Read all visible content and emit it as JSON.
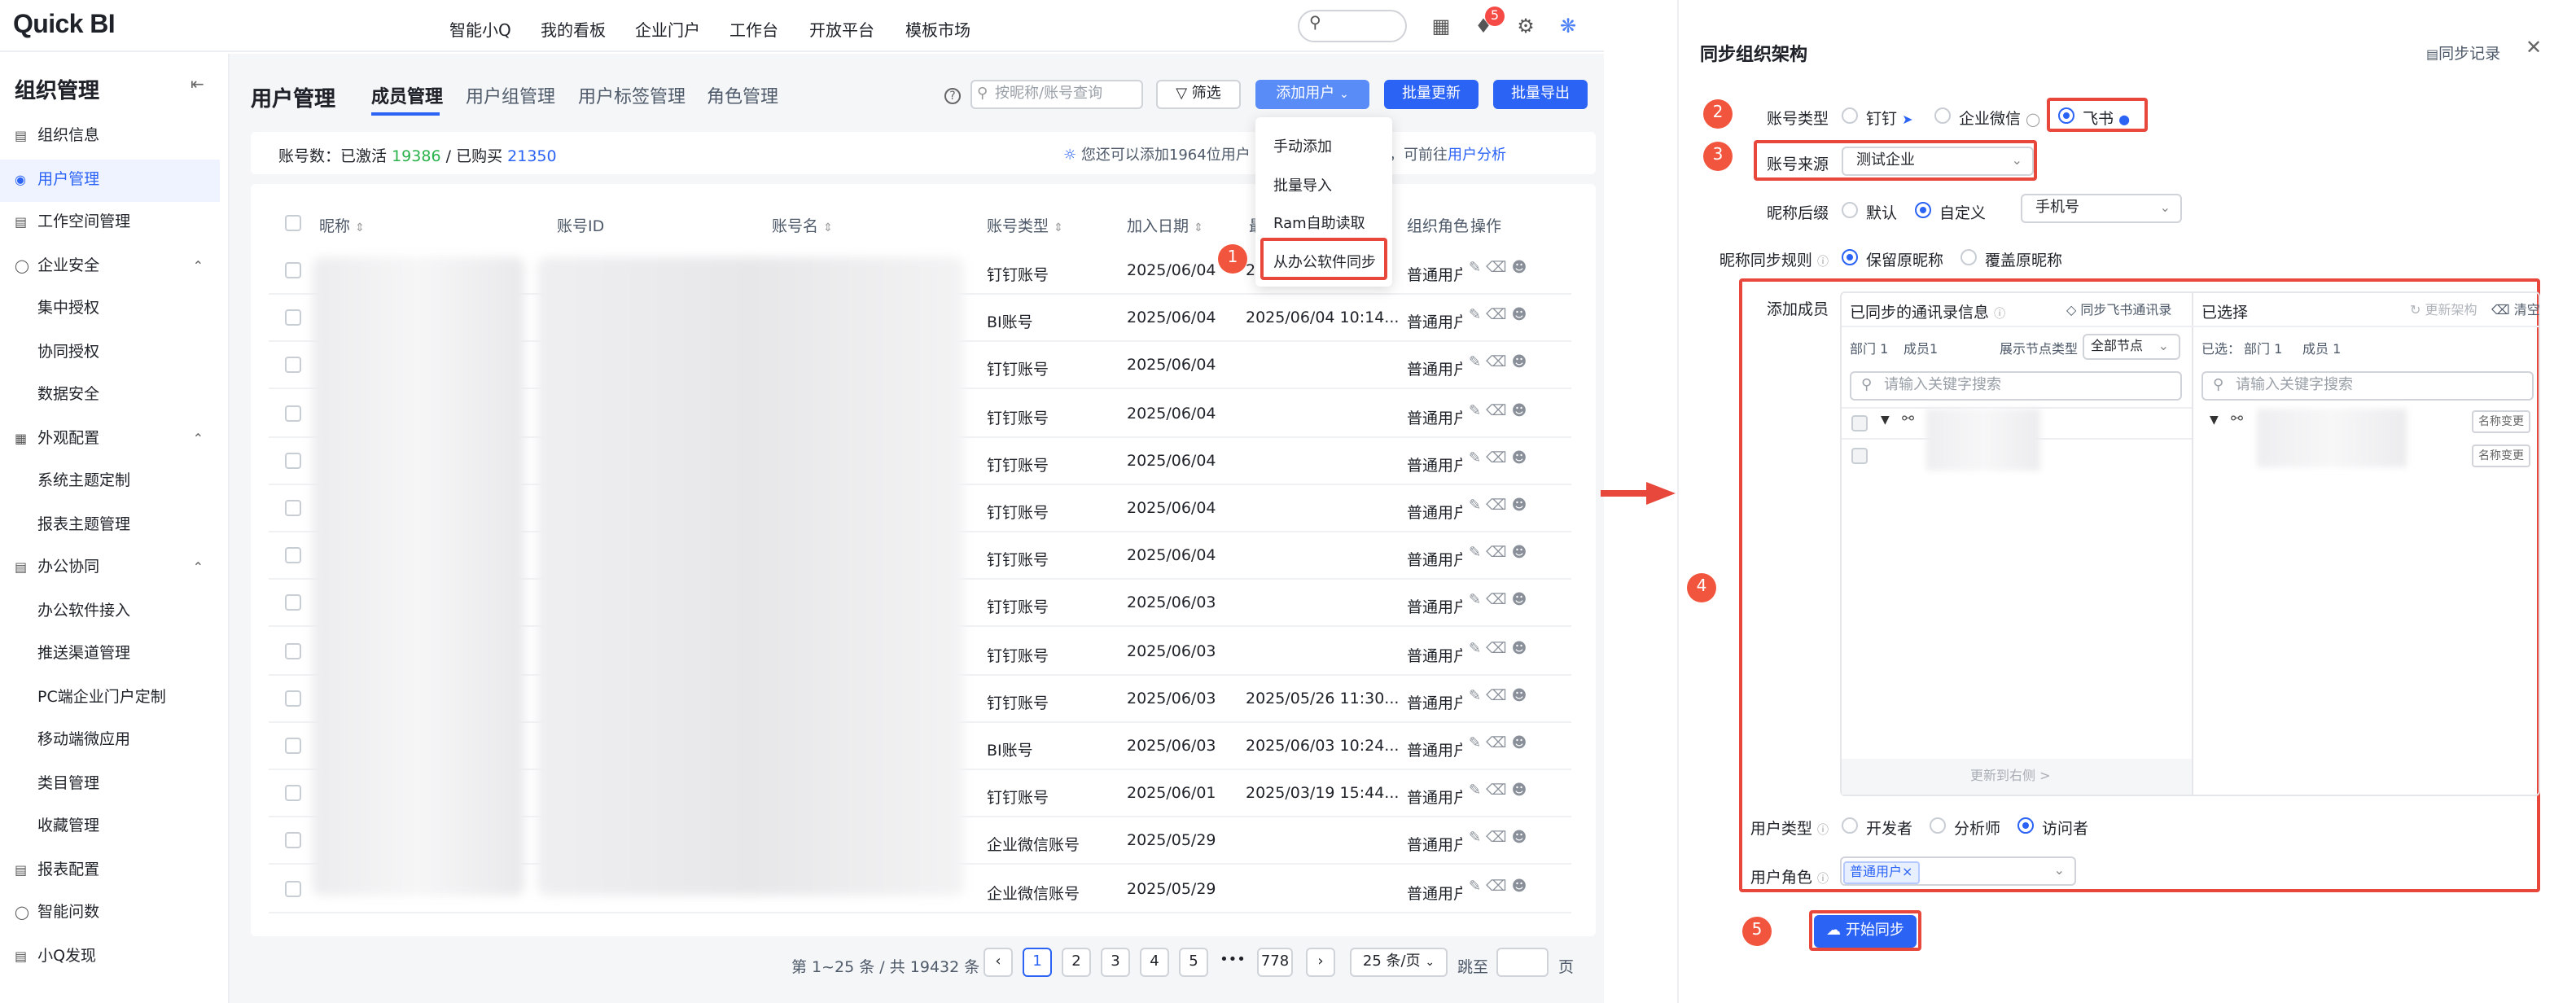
{
  "topbar": {
    "logo": "Quick BI",
    "nav": [
      "智能小Q",
      "我的看板",
      "企业门户",
      "工作台",
      "开放平台",
      "模板市场"
    ],
    "notifications": "5"
  },
  "sidebar": {
    "title": "组织管理",
    "items": [
      {
        "label": "组织信息",
        "icon": "org-icon"
      },
      {
        "label": "用户管理",
        "icon": "users-icon",
        "active": true
      },
      {
        "label": "工作空间管理",
        "icon": "workspace-icon"
      },
      {
        "label": "企业安全",
        "icon": "shield-icon",
        "expanded": true
      },
      {
        "label": "集中授权",
        "sub": true
      },
      {
        "label": "协同授权",
        "sub": true
      },
      {
        "label": "数据安全",
        "sub": true
      },
      {
        "label": "外观配置",
        "icon": "appearance-icon",
        "expanded": true
      },
      {
        "label": "系统主题定制",
        "sub": true
      },
      {
        "label": "报表主题管理",
        "sub": true
      },
      {
        "label": "办公协同",
        "icon": "office-icon",
        "expanded": true
      },
      {
        "label": "办公软件接入",
        "sub": true
      },
      {
        "label": "推送渠道管理",
        "sub": true
      },
      {
        "label": "PC端企业门户定制",
        "sub": true
      },
      {
        "label": "移动端微应用",
        "sub": true
      },
      {
        "label": "类目管理",
        "sub": true
      },
      {
        "label": "收藏管理",
        "sub": true
      },
      {
        "label": "报表配置",
        "icon": "report-icon"
      },
      {
        "label": "智能问数",
        "icon": "qa-icon"
      },
      {
        "label": "小Q发现",
        "icon": "discover-icon"
      }
    ]
  },
  "main": {
    "title": "用户管理",
    "tabs": [
      "成员管理",
      "用户组管理",
      "用户标签管理",
      "角色管理"
    ],
    "search_placeholder": "按昵称/账号查询",
    "filter_label": "筛选",
    "add_user_label": "添加用户",
    "batch_update_label": "批量更新",
    "batch_export_label": "批量导出",
    "stats": {
      "prefix": "账号数：已激活",
      "active": "19386",
      "sep": "/ 已购买",
      "purchased": "21350"
    },
    "notice_prefix": "您还可以添加1964位用户",
    "notice_suffix": "使用情况，可前往",
    "notice_link": "用户分析",
    "columns": [
      "昵称",
      "账号ID",
      "账号名",
      "账号类型",
      "加入日期",
      "最",
      "组织角色",
      "操作"
    ],
    "rows": [
      {
        "type": "钉钉账号",
        "date": "2025/06/04",
        "last": "2",
        "role": "普通用户"
      },
      {
        "type": "BI账号",
        "date": "2025/06/04",
        "last": "2025/06/04 10:14...",
        "role": "普通用户"
      },
      {
        "type": "钉钉账号",
        "date": "2025/06/04",
        "last": "",
        "role": "普通用户"
      },
      {
        "type": "钉钉账号",
        "date": "2025/06/04",
        "last": "",
        "role": "普通用户"
      },
      {
        "type": "钉钉账号",
        "date": "2025/06/04",
        "last": "",
        "role": "普通用户"
      },
      {
        "type": "钉钉账号",
        "date": "2025/06/04",
        "last": "",
        "role": "普通用户"
      },
      {
        "type": "钉钉账号",
        "date": "2025/06/04",
        "last": "",
        "role": "普通用户"
      },
      {
        "type": "钉钉账号",
        "date": "2025/06/03",
        "last": "",
        "role": "普通用户"
      },
      {
        "type": "钉钉账号",
        "date": "2025/06/03",
        "last": "",
        "role": "普通用户"
      },
      {
        "type": "钉钉账号",
        "date": "2025/06/03",
        "last": "2025/05/26 11:30...",
        "role": "普通用户"
      },
      {
        "type": "BI账号",
        "date": "2025/06/03",
        "last": "2025/06/03 10:24...",
        "role": "普通用户"
      },
      {
        "type": "钉钉账号",
        "date": "2025/06/01",
        "last": "2025/03/19 15:44...",
        "role": "普通用户"
      },
      {
        "type": "企业微信账号",
        "date": "2025/05/29",
        "last": "",
        "role": "普通用户"
      },
      {
        "type": "企业微信账号",
        "date": "2025/05/29",
        "last": "",
        "role": "普通用户"
      }
    ],
    "dropdown": [
      "手动添加",
      "批量导入",
      "Ram自助读取",
      "从办公软件同步"
    ],
    "pager": {
      "summary": "第 1~25 条 / 共 19432 条",
      "pages": [
        "1",
        "2",
        "3",
        "4",
        "5",
        "•••",
        "778"
      ],
      "page_size": "25 条/页",
      "jump": "跳至",
      "page_unit": "页"
    }
  },
  "steps": [
    "1",
    "2",
    "3",
    "4",
    "5"
  ],
  "panel": {
    "title": "同步组织架构",
    "record_link": "同步记录",
    "account_type_label": "账号类型",
    "account_types": [
      "钉钉",
      "企业微信",
      "飞书"
    ],
    "account_type_selected": "飞书",
    "source_label": "账号来源",
    "source_value": "测试企业",
    "suffix_label": "昵称后缀",
    "suffix_options": [
      "默认",
      "自定义"
    ],
    "suffix_selected": "自定义",
    "suffix_value": "手机号",
    "rule_label": "昵称同步规则",
    "rule_options": [
      "保留原昵称",
      "覆盖原昵称"
    ],
    "rule_selected": "保留原昵称",
    "members_label": "添加成员",
    "left": {
      "title": "已同步的通讯录信息",
      "sync_link": "同步飞书通讯录",
      "dept_count": "部门 1",
      "member_count": "成员1",
      "node_type_label": "展示节点类型",
      "node_type_value": "全部节点",
      "search_placeholder": "请输入关键字搜索",
      "footer": "更新到右侧 >"
    },
    "right": {
      "title": "已选择",
      "update_link": "更新架构",
      "clear_link": "清空",
      "selected_prefix": "已选：",
      "dept_count": "部门 1",
      "member_count": "成员 1",
      "search_placeholder": "请输入关键字搜索",
      "rename_label": "名称变更"
    },
    "user_type_label": "用户类型",
    "user_types": [
      "开发者",
      "分析师",
      "访问者"
    ],
    "user_type_selected": "访问者",
    "role_label": "用户角色",
    "role_tag": "普通用户",
    "start_label": "开始同步"
  },
  "colors": {
    "accent": "#2b63f5",
    "highlight": "#e8473c",
    "success": "#2bb24c"
  }
}
